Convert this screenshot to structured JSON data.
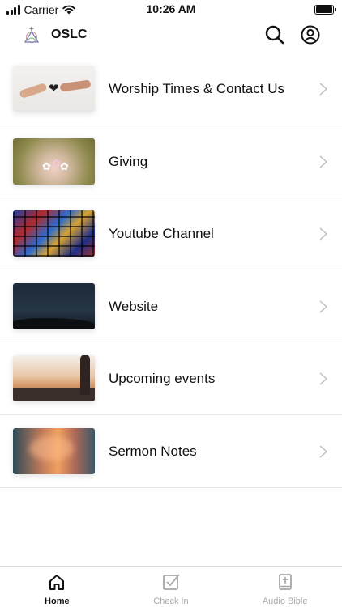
{
  "status_bar": {
    "carrier": "Carrier",
    "time": "10:26 AM",
    "battery_level": 1.0
  },
  "header": {
    "title": "OSLC",
    "logo_icon": "church-logo-icon",
    "search_icon": "search-icon",
    "account_icon": "account-circle-icon"
  },
  "menu": {
    "items": [
      {
        "label": "Worship Times & Contact Us",
        "thumbnail": "hands-with-heart"
      },
      {
        "label": "Giving",
        "thumbnail": "hands-holding-flowers"
      },
      {
        "label": "Youtube Channel",
        "thumbnail": "stained-glass"
      },
      {
        "label": "Website",
        "thumbnail": "night-sky"
      },
      {
        "label": "Upcoming events",
        "thumbnail": "sunset-people"
      },
      {
        "label": "Sermon Notes",
        "thumbnail": "sunset-clouds"
      }
    ]
  },
  "tab_bar": {
    "tabs": [
      {
        "label": "Home",
        "icon": "home-icon",
        "active": true
      },
      {
        "label": "Check In",
        "icon": "checkbox-icon",
        "active": false
      },
      {
        "label": "Audio Bible",
        "icon": "bible-icon",
        "active": false
      }
    ],
    "active_color": "#111111",
    "inactive_color": "#a8a8a8"
  }
}
